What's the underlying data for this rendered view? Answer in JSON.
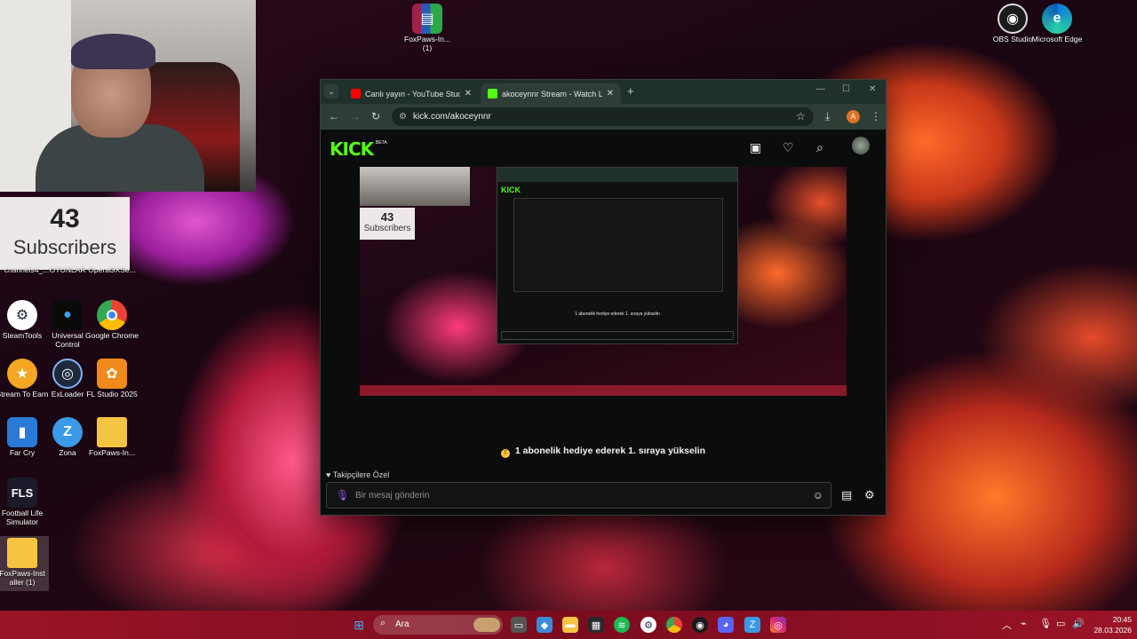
{
  "webcam": {
    "label": "webcam-feed"
  },
  "subscribers": {
    "count": "43",
    "label": "Subscribers"
  },
  "desktop_icons": [
    {
      "name": "channels4_...",
      "label": "channels4_..."
    },
    {
      "name": "OYUNLAR",
      "label": "OYUNLAR"
    },
    {
      "name": "OperaGXSe...",
      "label": "OperaGXSe..."
    },
    {
      "name": "SteamTools",
      "label": "SteamTools"
    },
    {
      "name": "Universal Control",
      "label": "Universal Control"
    },
    {
      "name": "Google Chrome",
      "label": "Google Chrome"
    },
    {
      "name": "Stream To Earn",
      "label": "Stream To Earn"
    },
    {
      "name": "ExLoader",
      "label": "ExLoader"
    },
    {
      "name": "FL Studio 2025",
      "label": "FL Studio 2025"
    },
    {
      "name": "Far Cry",
      "label": "Far Cry"
    },
    {
      "name": "Zona",
      "label": "Zona"
    },
    {
      "name": "FoxPaws-In...",
      "label": "FoxPaws-In..."
    },
    {
      "name": "Football Life Simulator",
      "label": "Football Life Simulator"
    },
    {
      "name": "FoxPaws-Installer (1)",
      "label": "FoxPaws-Inst aller (1)"
    },
    {
      "name": "FoxPaws-In... (1)",
      "label": "FoxPaws-In... (1)"
    },
    {
      "name": "OBS Studio",
      "label": "OBS Studio"
    },
    {
      "name": "Microsoft Edge",
      "label": "Microsoft Edge"
    }
  ],
  "browser": {
    "tabs": [
      {
        "title": "Canlı yayın - YouTube Studio",
        "close": "✕"
      },
      {
        "title": "akoceynnr Stream - Watch Live",
        "close": "✕"
      }
    ],
    "new_tab": "+",
    "url": "kick.com/akoceynnr",
    "profile_initial": "A"
  },
  "kick": {
    "logo": "KICK",
    "beta": "BETA",
    "gift_message": "1 abonelik hediye ederek 1. sıraya yükselin",
    "follower_only": "Takipçilere Özel",
    "chat_placeholder": "Bir mesaj gönderin",
    "mini_subs_count": "43",
    "mini_subs_label": "Subscribers",
    "mini_logo": "KICK",
    "mini_gift": "1 abonelik hediye ederek 1. sıraya yükselin"
  },
  "taskbar": {
    "search_text": "Ara",
    "time": "20:45",
    "date": "28.03.2026"
  },
  "colors": {
    "kick_green": "#53fc18",
    "taskbar": "#9a1426",
    "browser_chrome": "#20302a"
  }
}
